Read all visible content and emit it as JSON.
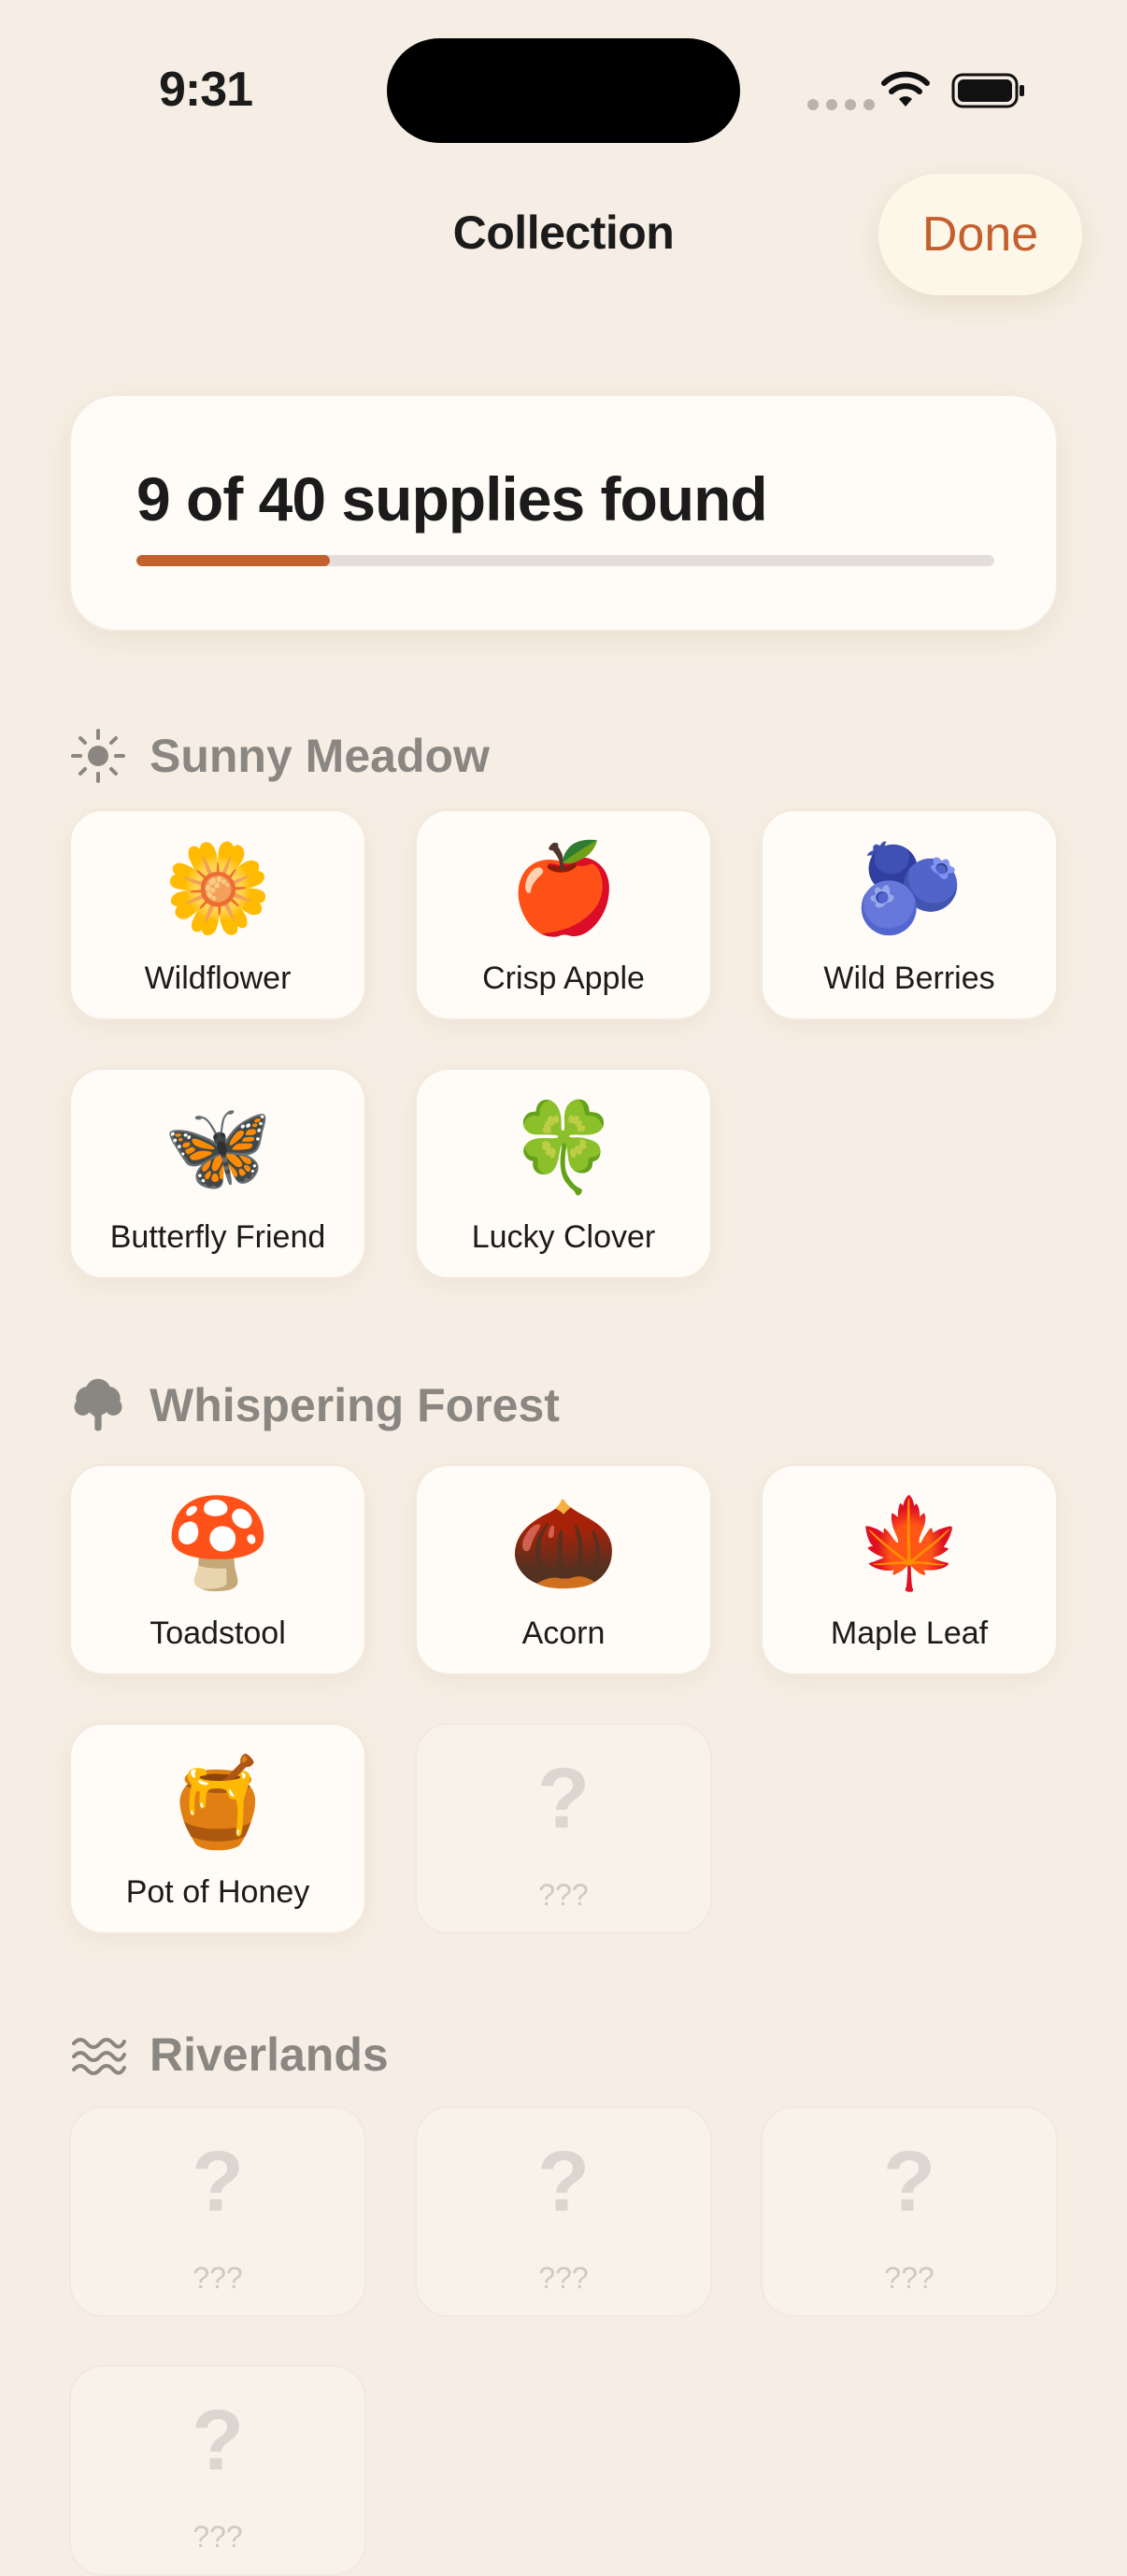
{
  "status_bar": {
    "time": "9:31"
  },
  "header": {
    "title": "Collection",
    "done_label": "Done"
  },
  "progress": {
    "text": "9 of 40 supplies found",
    "found": 9,
    "total": 40,
    "accent": "#c45f2e"
  },
  "sections": [
    {
      "title": "Sunny Meadow",
      "icon": "sun-icon",
      "items": [
        {
          "emoji": "🌼",
          "label": "Wildflower",
          "locked": false
        },
        {
          "emoji": "🍎",
          "label": "Crisp Apple",
          "locked": false
        },
        {
          "emoji": "🫐",
          "label": "Wild Berries",
          "locked": false
        },
        {
          "emoji": "🦋",
          "label": "Butterfly Friend",
          "locked": false
        },
        {
          "emoji": "🍀",
          "label": "Lucky Clover",
          "locked": false
        }
      ]
    },
    {
      "title": "Whispering Forest",
      "icon": "tree-icon",
      "items": [
        {
          "emoji": "🍄",
          "label": "Toadstool",
          "locked": false
        },
        {
          "emoji": "🌰",
          "label": "Acorn",
          "locked": false
        },
        {
          "emoji": "🍁",
          "label": "Maple Leaf",
          "locked": false
        },
        {
          "emoji": "🍯",
          "label": "Pot of Honey",
          "locked": false
        },
        {
          "emoji": "?",
          "label": "???",
          "locked": true
        }
      ]
    },
    {
      "title": "Riverlands",
      "icon": "water-waves-icon",
      "items": [
        {
          "emoji": "?",
          "label": "???",
          "locked": true
        },
        {
          "emoji": "?",
          "label": "???",
          "locked": true
        },
        {
          "emoji": "?",
          "label": "???",
          "locked": true
        },
        {
          "emoji": "?",
          "label": "???",
          "locked": true
        }
      ]
    }
  ]
}
